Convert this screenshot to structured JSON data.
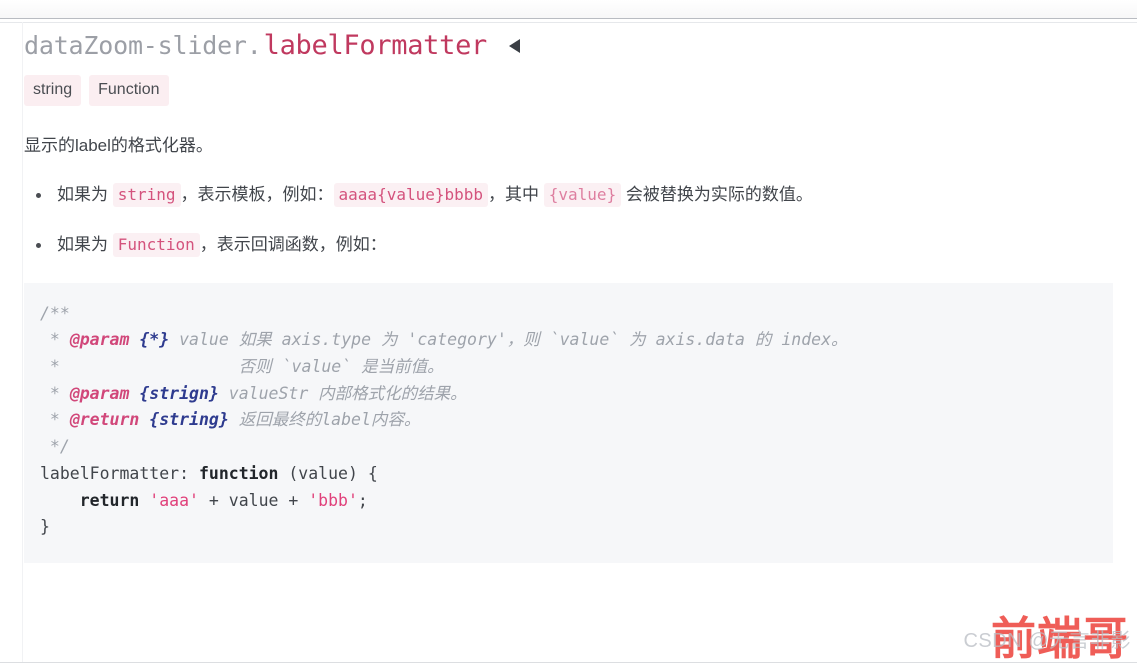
{
  "header": {
    "title_prefix": "dataZoom-slider.",
    "title_main": "labelFormatter",
    "collapse_icon": "triangle-left-icon"
  },
  "type_badges": [
    {
      "label": "string"
    },
    {
      "label": "Function"
    }
  ],
  "description": "显示的label的格式化器。",
  "bullets": [
    {
      "parts": [
        {
          "type": "text",
          "value": "如果为 "
        },
        {
          "type": "code",
          "value": "string"
        },
        {
          "type": "text",
          "value": "，表示模板，例如："
        },
        {
          "type": "code",
          "value": "aaaa{value}bbbb"
        },
        {
          "type": "text",
          "value": "，其中 "
        },
        {
          "type": "code-soft",
          "value": "{value}"
        },
        {
          "type": "text",
          "value": " 会被替换为实际的数值。"
        }
      ]
    },
    {
      "parts": [
        {
          "type": "text",
          "value": "如果为 "
        },
        {
          "type": "code",
          "value": "Function"
        },
        {
          "type": "text",
          "value": "，表示回调函数，例如："
        }
      ]
    }
  ],
  "code_block": {
    "language": "javascript",
    "lines": [
      {
        "tokens": [
          {
            "c": "cmt",
            "t": "/**"
          }
        ]
      },
      {
        "tokens": [
          {
            "c": "cmt",
            "t": " * "
          },
          {
            "c": "cmt-tag",
            "t": "@param"
          },
          {
            "c": "cmt",
            "t": " "
          },
          {
            "c": "cmt-type",
            "t": "{*}"
          },
          {
            "c": "cmt",
            "t": " value 如果 axis.type 为 'category'，则 `value` 为 axis.data 的 index。"
          }
        ]
      },
      {
        "tokens": [
          {
            "c": "cmt",
            "t": " *                  否则 `value` 是当前值。"
          }
        ]
      },
      {
        "tokens": [
          {
            "c": "cmt",
            "t": " * "
          },
          {
            "c": "cmt-tag",
            "t": "@param"
          },
          {
            "c": "cmt",
            "t": " "
          },
          {
            "c": "cmt-type",
            "t": "{strign}"
          },
          {
            "c": "cmt",
            "t": " valueStr 内部格式化的结果。"
          }
        ]
      },
      {
        "tokens": [
          {
            "c": "cmt",
            "t": " * "
          },
          {
            "c": "cmt-tag",
            "t": "@return"
          },
          {
            "c": "cmt",
            "t": " "
          },
          {
            "c": "cmt-type",
            "t": "{string}"
          },
          {
            "c": "cmt",
            "t": " 返回最终的label内容。"
          }
        ]
      },
      {
        "tokens": [
          {
            "c": "cmt",
            "t": " */"
          }
        ]
      },
      {
        "tokens": [
          {
            "c": "plain",
            "t": "labelFormatter: "
          },
          {
            "c": "kw",
            "t": "function"
          },
          {
            "c": "plain",
            "t": " (value) {"
          }
        ]
      },
      {
        "tokens": [
          {
            "c": "plain",
            "t": "    "
          },
          {
            "c": "kw",
            "t": "return"
          },
          {
            "c": "plain",
            "t": " "
          },
          {
            "c": "str",
            "t": "'aaa'"
          },
          {
            "c": "plain",
            "t": " + value + "
          },
          {
            "c": "str",
            "t": "'bbb'"
          },
          {
            "c": "plain",
            "t": ";"
          }
        ]
      },
      {
        "tokens": [
          {
            "c": "plain",
            "t": "}"
          }
        ]
      }
    ]
  },
  "watermark": {
    "main": "前端哥",
    "sub": "CSDN @无言非影",
    "color": "#ec3a33"
  }
}
